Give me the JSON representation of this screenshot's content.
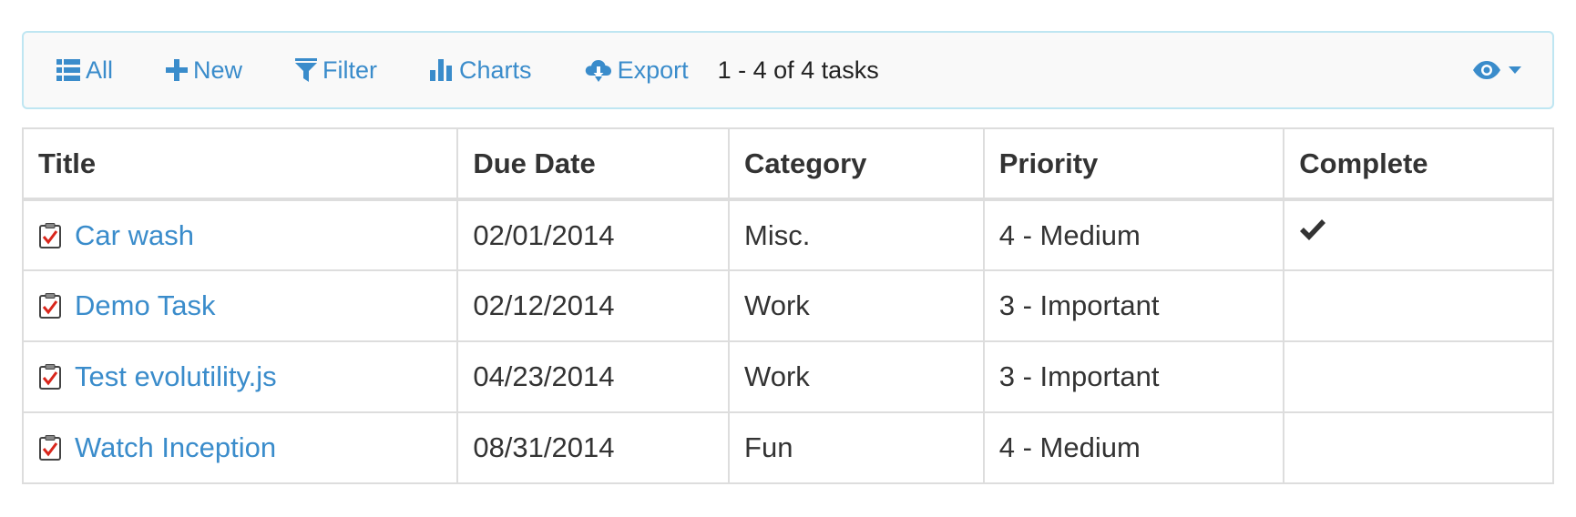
{
  "toolbar": {
    "buttons": [
      {
        "label": "All",
        "icon": "list-icon"
      },
      {
        "label": "New",
        "icon": "plus-icon"
      },
      {
        "label": "Filter",
        "icon": "filter-icon"
      },
      {
        "label": "Charts",
        "icon": "bar-chart-icon"
      },
      {
        "label": "Export",
        "icon": "cloud-download-icon"
      }
    ],
    "count_text": "1 - 4 of 4 tasks",
    "view_icon": "eye-icon"
  },
  "table": {
    "columns": [
      "Title",
      "Due Date",
      "Category",
      "Priority",
      "Complete"
    ],
    "rows": [
      {
        "title": "Car wash",
        "due_date": "02/01/2014",
        "category": "Misc.",
        "priority": "4 - Medium",
        "complete": true
      },
      {
        "title": "Demo Task",
        "due_date": "02/12/2014",
        "category": "Work",
        "priority": "3 - Important",
        "complete": false
      },
      {
        "title": "Test evolutility.js",
        "due_date": "04/23/2014",
        "category": "Work",
        "priority": "3 - Important",
        "complete": false
      },
      {
        "title": "Watch Inception",
        "due_date": "08/31/2014",
        "category": "Fun",
        "priority": "4 - Medium",
        "complete": false
      }
    ]
  },
  "colors": {
    "link": "#3a8ccb",
    "toolbar_border": "#bfe6f2",
    "toolbar_bg": "#f9f9f9",
    "grid_border": "#dddddd"
  }
}
